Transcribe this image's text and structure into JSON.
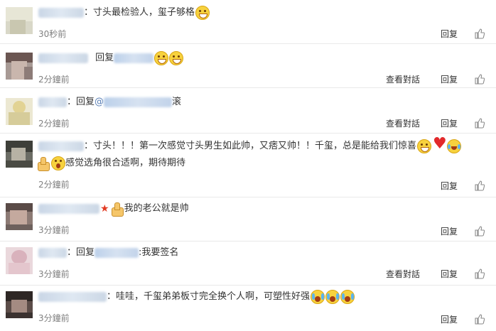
{
  "comments": [
    {
      "text": "：寸头最检验人，玺子够格",
      "time": "30秒前",
      "has_view_conversation": false,
      "emojis": [
        "grin-emoji"
      ]
    },
    {
      "reply_word": "回复",
      "time": "2分鐘前",
      "has_view_conversation": true,
      "emojis": [
        "grin-emoji",
        "grin-emoji"
      ]
    },
    {
      "reply_word": "：回复",
      "mention_prefix": "@",
      "text": "滚",
      "time": "2分鐘前",
      "has_view_conversation": true
    },
    {
      "text": "：寸头！！！第一次感觉寸头男生如此帅，又痞又帅！！千玺，总是能给我们惊喜",
      "text_line2": "感觉选角很合适啊，期待期待",
      "time": "2分鐘前",
      "has_view_conversation": false,
      "emojis": [
        "smile-emoji",
        "heart-emoji",
        "laugh-cry-emoji"
      ],
      "emojis_line2": [
        "thumbs-up-emoji",
        "astonished-emoji"
      ]
    },
    {
      "text": "我的老公就是帅",
      "time": "3分鐘前",
      "has_view_conversation": false,
      "emojis": [
        "thumbs-up-emoji"
      ]
    },
    {
      "reply_word": "：回复",
      "text": ":我要签名",
      "time": "3分鐘前",
      "has_view_conversation": true
    },
    {
      "text": "：哇哇，千玺弟弟板寸完全换个人啊，可塑性好强",
      "time": "3分鐘前",
      "has_view_conversation": false,
      "emojis": [
        "crying-emoji",
        "crying-emoji",
        "crying-emoji"
      ]
    }
  ],
  "actions": {
    "view_conversation": "查看對話",
    "reply": "回复"
  },
  "icons": {
    "like": "thumbs-up-icon",
    "badge": "star-icon"
  },
  "colors": {
    "text": "#333333",
    "time": "#808080",
    "divider": "#e9e9e9",
    "star": "#e23a22"
  }
}
